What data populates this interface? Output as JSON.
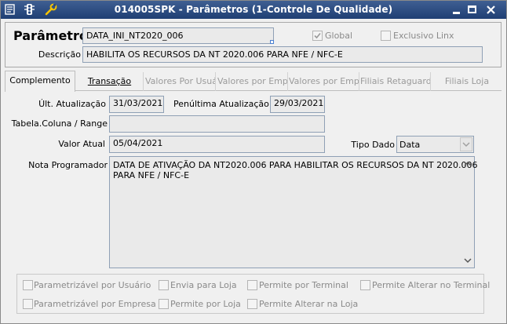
{
  "window": {
    "title": "014005SPK - Parâmetros (1-Controle De Qualidade)"
  },
  "header": {
    "parametro_label": "Parâmetro",
    "parametro_value": "DATA_INI_NT2020_006",
    "global_label": "Global",
    "global_checked": true,
    "exclusivo_label": "Exclusivo Linx",
    "exclusivo_checked": false,
    "descricao_label": "Descrição",
    "descricao_value": "HABILITA OS RECURSOS DA NT 2020.006 PARA NFE / NFC-E"
  },
  "tabs": [
    {
      "label": "Complemento"
    },
    {
      "label": "Transação"
    },
    {
      "label": "Valores Por Usuár"
    },
    {
      "label": "Valores por Empre"
    },
    {
      "label": "Valores por Empre"
    },
    {
      "label": "Filiais Retaguarda"
    },
    {
      "label": "Filiais Loja"
    }
  ],
  "complemento": {
    "ult_atualizacao_label": "Últ. Atualização",
    "ult_atualizacao_value": "31/03/2021",
    "penultima_label": "Penúltima Atualização",
    "penultima_value": "29/03/2021",
    "tabela_label": "Tabela.Coluna / Range",
    "tabela_value": "",
    "valor_atual_label": "Valor Atual",
    "valor_atual_value": "05/04/2021",
    "tipo_dado_label": "Tipo Dado",
    "tipo_dado_value": "Data",
    "nota_label": "Nota Programador",
    "nota_line1": "DATA DE ATIVAÇÃO DA NT2020.006 PARA HABILITAR OS RECURSOS DA NT 2020.006",
    "nota_line2": "PARA NFE / NFC-E"
  },
  "options": {
    "parametrizavel_usuario": "Parametrizável por Usuário",
    "envia_para_loja": "Envia para Loja",
    "permite_por_terminal": "Permite por Terminal",
    "permite_alterar_terminal": "Permite Alterar no Terminal",
    "parametrizavel_empresa": "Parametrizável por Empresa",
    "permite_por_loja": "Permite por Loja",
    "permite_alterar_loja": "Permite Alterar na Loja"
  },
  "colors": {
    "titlebar": "#2a4a80",
    "field_border": "#8fa0b5",
    "disabled_text": "#8a8a8a"
  }
}
